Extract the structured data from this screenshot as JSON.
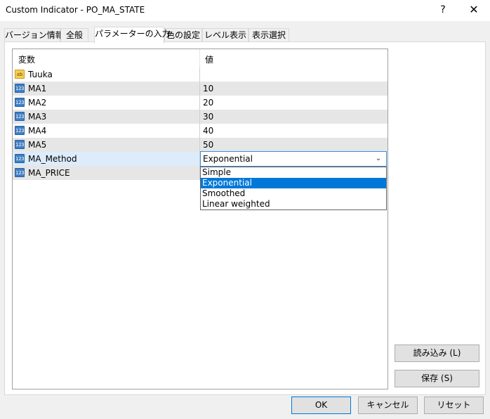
{
  "window": {
    "title": "Custom Indicator - PO_MA_STATE",
    "help_label": "?",
    "close_label": "✕"
  },
  "tabs": [
    {
      "label": "バージョン情報"
    },
    {
      "label": "全般"
    },
    {
      "label": "パラメーターの入力"
    },
    {
      "label": "色の設定"
    },
    {
      "label": "レベル表示"
    },
    {
      "label": "表示選択"
    }
  ],
  "grid": {
    "headers": {
      "variable": "変数",
      "value": "値"
    },
    "rows": [
      {
        "name": "Tuuka",
        "value": "",
        "type_icon": "ab"
      },
      {
        "name": "MA1",
        "value": "10",
        "type_icon": "123"
      },
      {
        "name": "MA2",
        "value": "20",
        "type_icon": "123"
      },
      {
        "name": "MA3",
        "value": "30",
        "type_icon": "123"
      },
      {
        "name": "MA4",
        "value": "40",
        "type_icon": "123"
      },
      {
        "name": "MA5",
        "value": "50",
        "type_icon": "123"
      },
      {
        "name": "MA_Method",
        "value": "",
        "type_icon": "123"
      },
      {
        "name": "MA_PRICE",
        "value": "",
        "type_icon": "123"
      }
    ]
  },
  "combo": {
    "selected": "Exponential",
    "options": [
      "Simple",
      "Exponential",
      "Smoothed",
      "Linear weighted"
    ]
  },
  "side_buttons": {
    "load": "読み込み (L)",
    "save": "保存 (S)"
  },
  "footer_buttons": {
    "ok": "OK",
    "cancel": "キャンセル",
    "reset": "リセット"
  },
  "colors": {
    "selection": "#0078d7",
    "row_gray": "#e6e6e6",
    "row_selected": "#dcecfb"
  }
}
